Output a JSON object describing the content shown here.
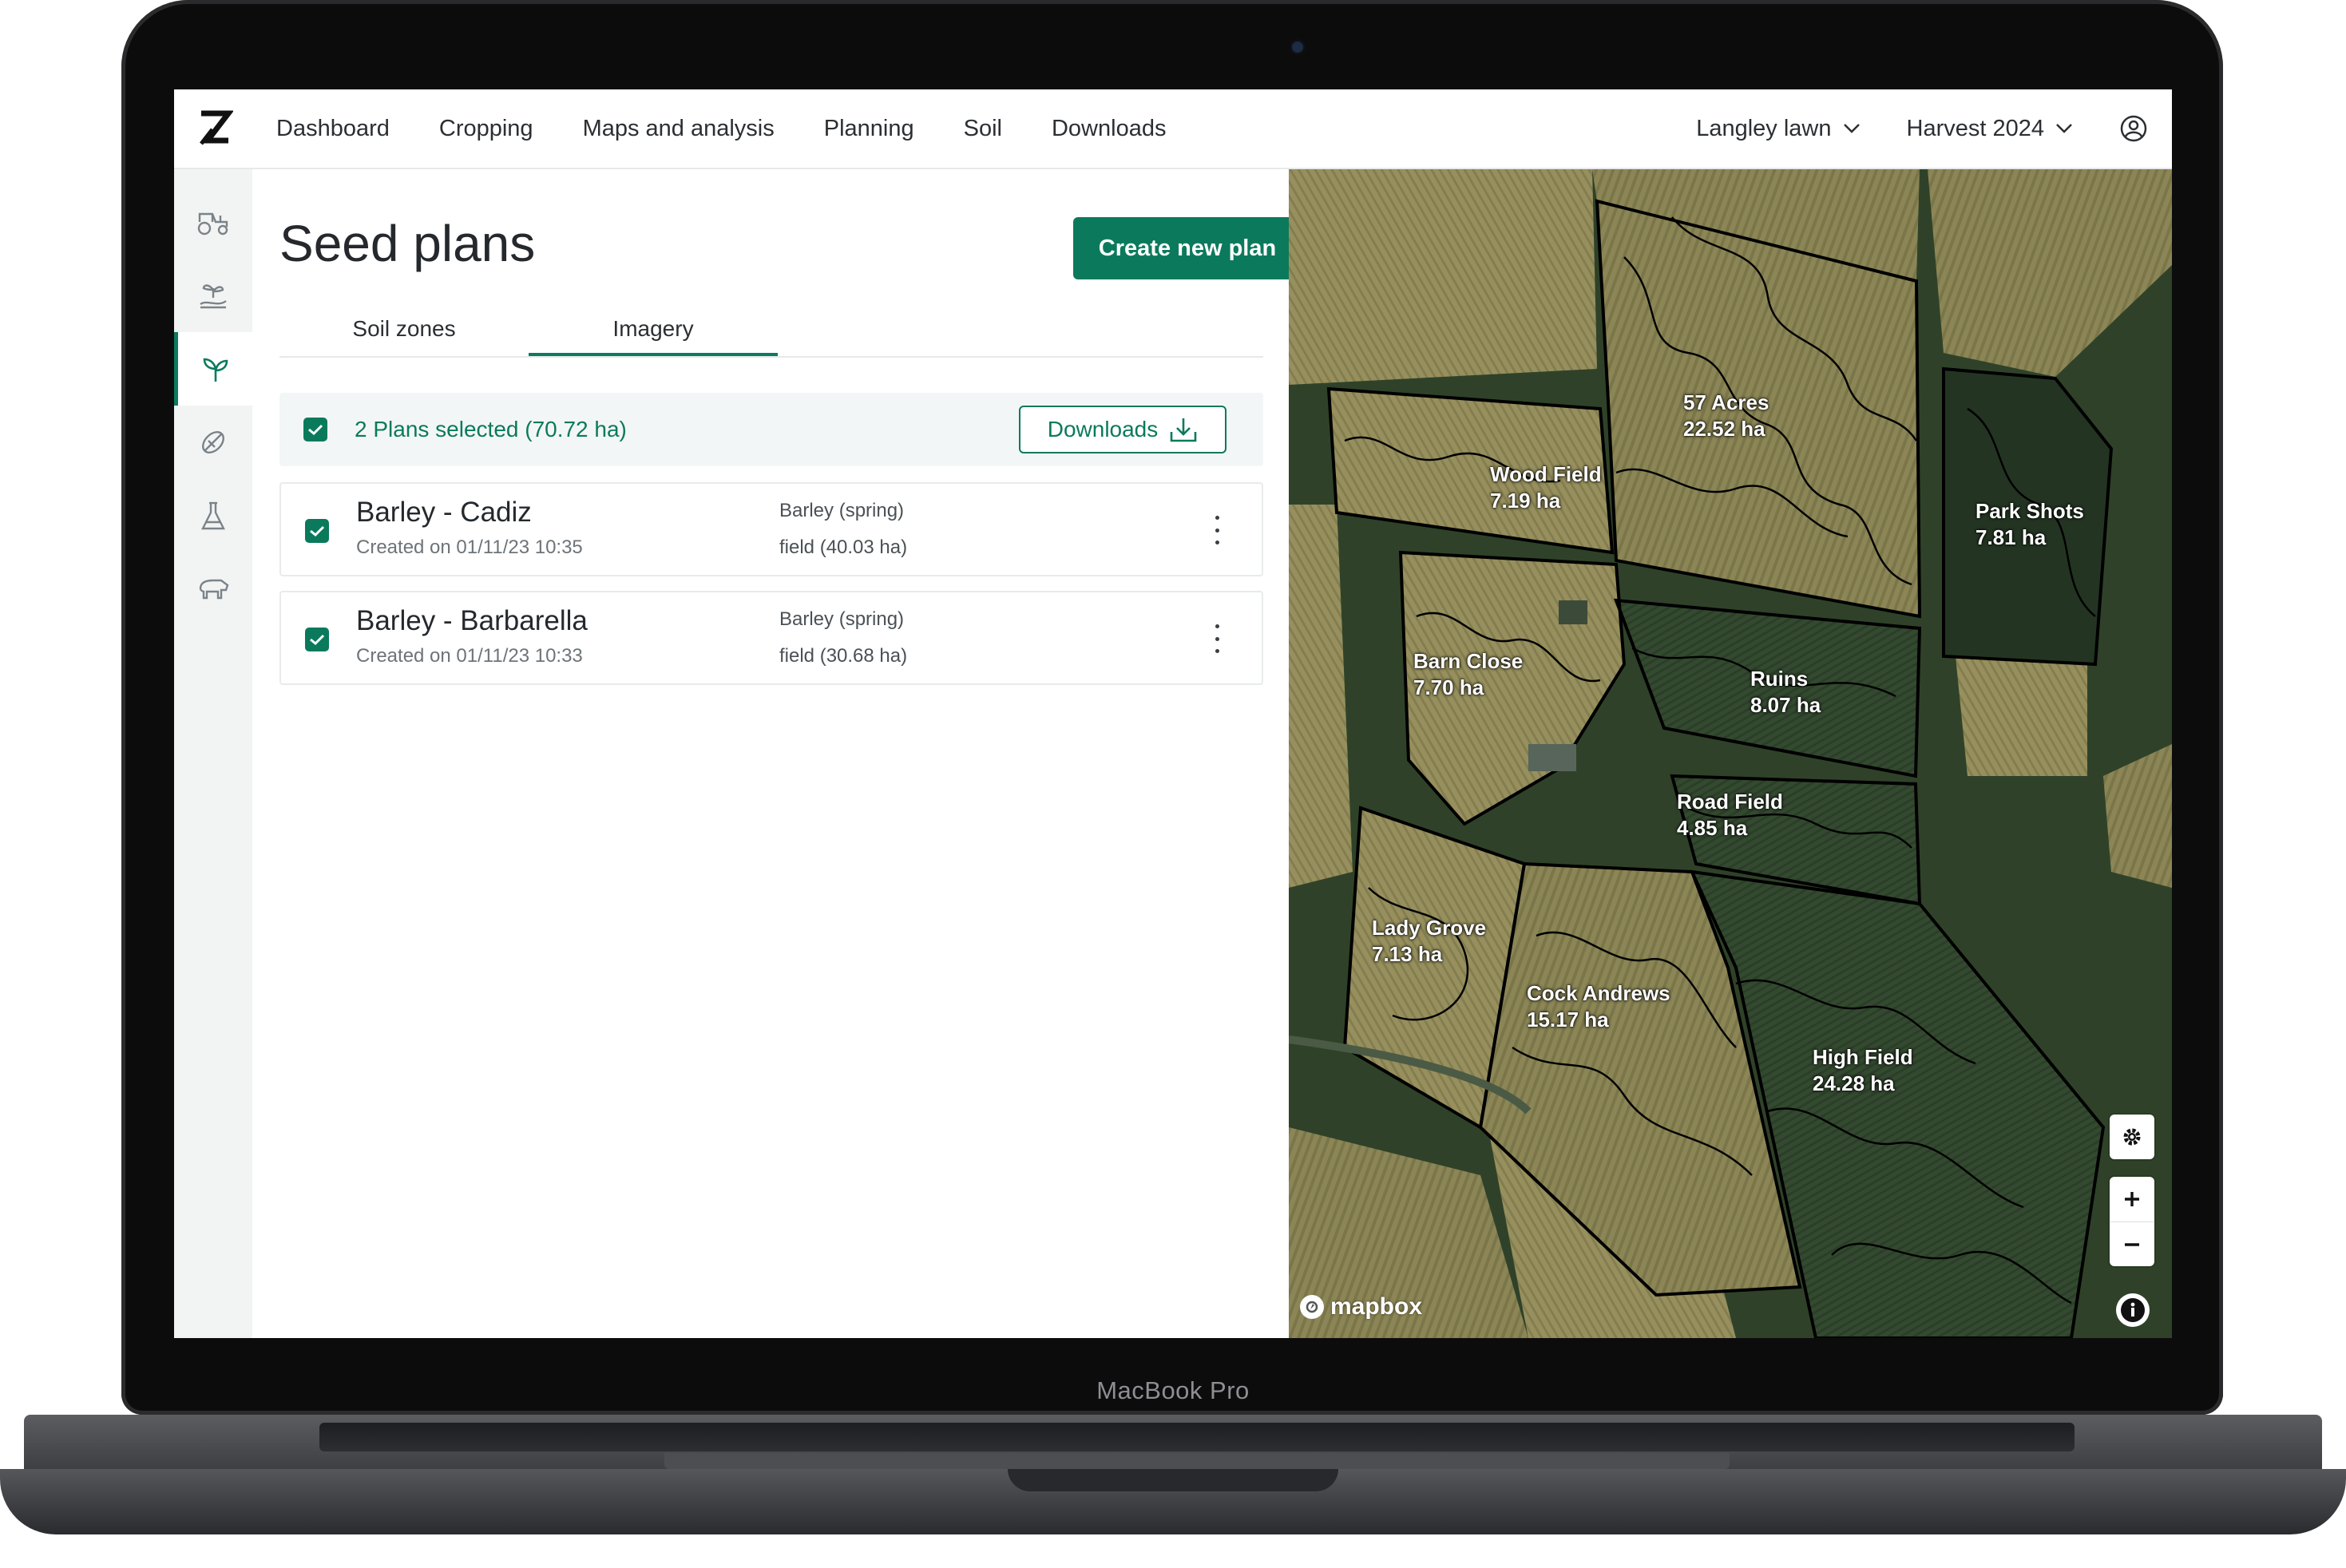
{
  "device": {
    "label": "MacBook Pro"
  },
  "nav": {
    "items": [
      "Dashboard",
      "Cropping",
      "Maps and analysis",
      "Planning",
      "Soil",
      "Downloads"
    ],
    "farm": "Langley lawn",
    "harvest": "Harvest 2024"
  },
  "sidebar": {
    "items": [
      "tractor-icon",
      "seedling-hand-icon",
      "sprout-icon",
      "seed-icon",
      "flask-icon",
      "livestock-icon"
    ],
    "active_index": 2
  },
  "page": {
    "title": "Seed plans",
    "create_button": "Create new plan",
    "tabs": [
      "Soil zones",
      "Imagery"
    ],
    "active_tab": 1,
    "selection": {
      "text": "2 Plans selected (70.72 ha)",
      "download_button": "Downloads"
    },
    "plans": [
      {
        "name": "Barley - Cadiz",
        "created": "Created on 01/11/23 10:35",
        "crop": "Barley (spring)",
        "field": "field (40.03 ha)",
        "checked": true
      },
      {
        "name": "Barley - Barbarella",
        "created": "Created on 01/11/23 10:33",
        "crop": "Barley (spring)",
        "field": "field (30.68 ha)",
        "checked": true
      }
    ]
  },
  "map": {
    "fields": [
      {
        "name": "57 Acres",
        "area": "22.52 ha"
      },
      {
        "name": "Wood Field",
        "area": "7.19 ha"
      },
      {
        "name": "Park Shots",
        "area": "7.81 ha"
      },
      {
        "name": "Barn Close",
        "area": "7.70 ha"
      },
      {
        "name": "Ruins",
        "area": "8.07 ha"
      },
      {
        "name": "Road Field",
        "area": "4.85 ha"
      },
      {
        "name": "Lady Grove",
        "area": "7.13 ha"
      },
      {
        "name": "Cock Andrews",
        "area": "15.17 ha"
      },
      {
        "name": "High Field",
        "area": "24.28 ha"
      }
    ],
    "attribution": "mapbox"
  },
  "colors": {
    "accent": "#0b7a5c",
    "map_dark": "#2c3d28",
    "map_light": "#6f7448"
  }
}
